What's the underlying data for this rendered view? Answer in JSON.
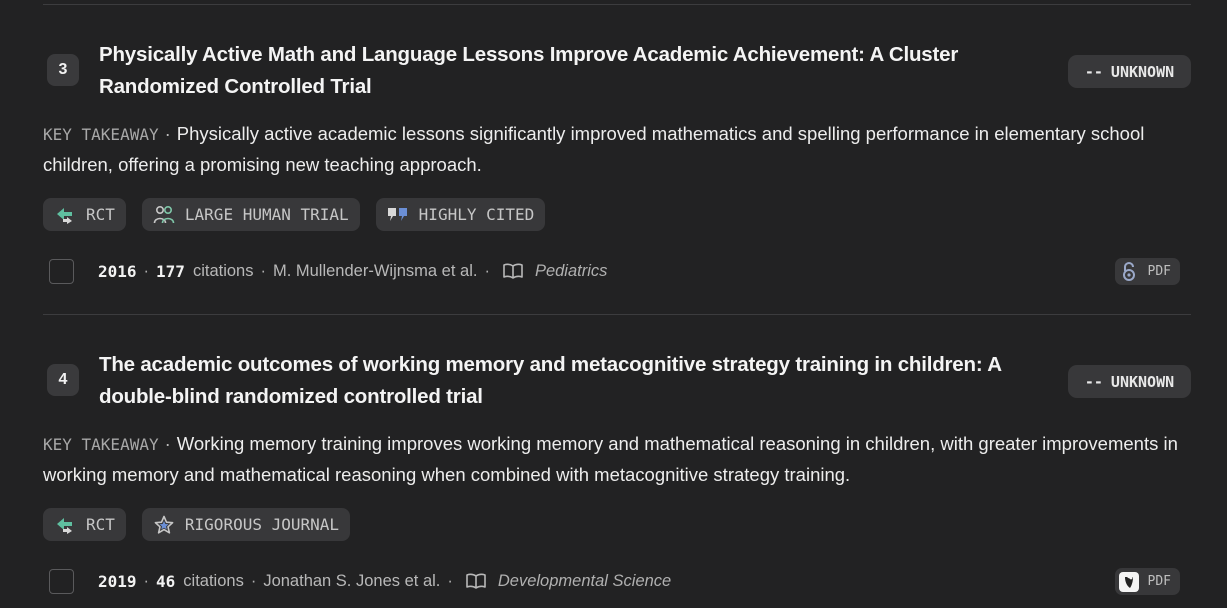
{
  "results": [
    {
      "rank": "3",
      "title": "Physically Active Math and Language Lessons Improve Academic Achievement: A Cluster Randomized Controlled Trial",
      "status": {
        "dash": "--",
        "label": "UNKNOWN"
      },
      "takeaway_label": "KEY TAKEAWAY",
      "takeaway_sep": "·",
      "takeaway": "Physically active academic lessons significantly improved mathematics and spelling performance in elementary school children, offering a promising new teaching approach.",
      "tags": [
        {
          "label": "RCT",
          "icon": "rct-arrows-icon"
        },
        {
          "label": "LARGE HUMAN TRIAL",
          "icon": "people-icon"
        },
        {
          "label": "HIGHLY CITED",
          "icon": "quote-icon"
        }
      ],
      "year": "2016",
      "citations_count": "177",
      "citations_label": "citations",
      "authors": "M. Mullender-Wijnsma et al.",
      "journal": "Pediatrics",
      "pdf_label": "PDF",
      "pdf_icon": "open-access-lock-icon"
    },
    {
      "rank": "4",
      "title": "The academic outcomes of working memory and metacognitive strategy training in children: A double-blind randomized controlled trial",
      "status": {
        "dash": "--",
        "label": "UNKNOWN"
      },
      "takeaway_label": "KEY TAKEAWAY",
      "takeaway_sep": "·",
      "takeaway": "Working memory training improves working memory and mathematical reasoning in children, with greater improvements in working memory and mathematical reasoning when combined with metacognitive strategy training.",
      "tags": [
        {
          "label": "RCT",
          "icon": "rct-arrows-icon"
        },
        {
          "label": "RIGOROUS JOURNAL",
          "icon": "star-icon"
        }
      ],
      "year": "2019",
      "citations_count": "46",
      "citations_label": "citations",
      "authors": "Jonathan S. Jones et al.",
      "journal": "Developmental Science",
      "pdf_label": "PDF",
      "pdf_icon": "wiley-logo-icon"
    }
  ],
  "meta_sep": "·",
  "colors": {
    "background": "#222223",
    "chip": "#38383a",
    "rct_icon": "#5fbfa0",
    "open_access": "#9aa8c8",
    "quote_icon": "#6b8fd6"
  }
}
